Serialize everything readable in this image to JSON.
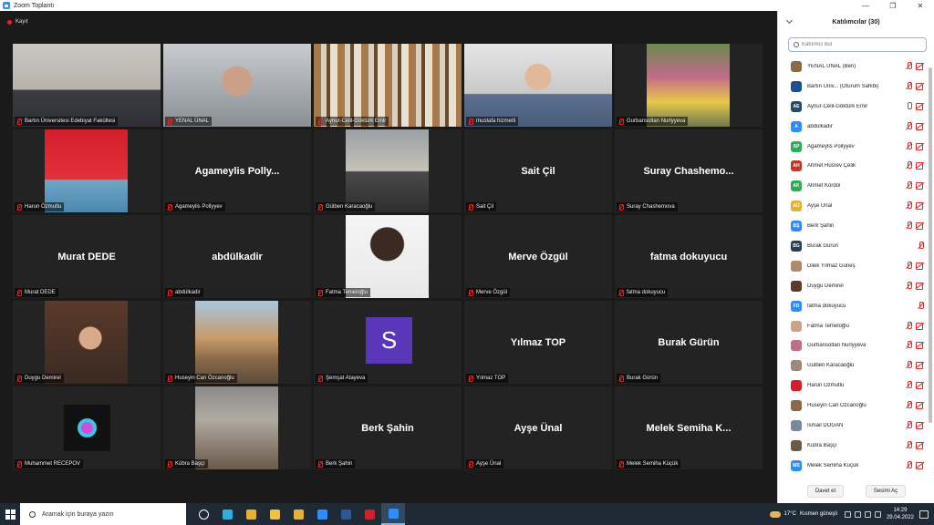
{
  "window": {
    "title": "Zoom Toplantı",
    "controls": [
      "—",
      "❐",
      "✕"
    ]
  },
  "recording": {
    "label": "Kayıt"
  },
  "gallery": {
    "tiles": [
      {
        "name": "Bartın Üniversitesi Edebiyat Fakültesi",
        "big": "",
        "video": "v-office",
        "active": false
      },
      {
        "name": "YENAL ÜNAL",
        "big": "",
        "video": "v-face",
        "active": false
      },
      {
        "name": "Aynur-Celil-Göktürk Emir",
        "big": "",
        "video": "v-shelf",
        "active": true
      },
      {
        "name": "mustafa hizmetli",
        "big": "",
        "video": "v-person",
        "active": false
      },
      {
        "name": "Gurbansoltan Nurlyyeva",
        "big": "",
        "video": "v-photo1",
        "active": false
      },
      {
        "name": "Harun Özmutlu",
        "big": "",
        "video": "v-flag",
        "active": false
      },
      {
        "name": "Agameylis Pollyyev",
        "big": "Agameylis  Polly...",
        "video": "",
        "active": false
      },
      {
        "name": "Gülben Karacaoğlu",
        "big": "",
        "video": "v-building",
        "active": false
      },
      {
        "name": "Sait Çil",
        "big": "Sait Çil",
        "video": "",
        "active": false
      },
      {
        "name": "Suray Chashemova",
        "big": "Suray  Chashemo...",
        "video": "",
        "active": false
      },
      {
        "name": "Murat DEDE",
        "big": "Murat DEDE",
        "video": "",
        "active": false
      },
      {
        "name": "abdülkadir",
        "big": "abdülkadir",
        "video": "",
        "active": false
      },
      {
        "name": "Fatma Temeloğlu",
        "big": "",
        "video": "v-portrait",
        "active": false
      },
      {
        "name": "Merve Özgül",
        "big": "Merve Özgül",
        "video": "",
        "active": false
      },
      {
        "name": "fatma dokuyucu",
        "big": "fatma dokuyucu",
        "video": "",
        "active": false
      },
      {
        "name": "Duygu Demirel",
        "big": "",
        "video": "v-girl",
        "active": false
      },
      {
        "name": "Huseyin Can Özcanoğlu",
        "big": "",
        "video": "v-autumn",
        "active": false
      },
      {
        "name": "Şemşat Atayeva",
        "big": "",
        "video": "avatar-s",
        "active": false
      },
      {
        "name": "Yılmaz TOP",
        "big": "Yılmaz TOP",
        "video": "",
        "active": false
      },
      {
        "name": "Burak Gürün",
        "big": "Burak Gürün",
        "video": "",
        "active": false
      },
      {
        "name": "Muhammet RECEPOV",
        "big": "",
        "video": "v-dark",
        "active": false
      },
      {
        "name": "Kübra Başçı",
        "big": "",
        "video": "v-arch",
        "active": false
      },
      {
        "name": "Berk Şahin",
        "big": "Berk Şahin",
        "video": "",
        "active": false
      },
      {
        "name": "Ayşe Ünal",
        "big": "Ayşe Ünal",
        "video": "",
        "active": false
      },
      {
        "name": "Melek Semiha Küçük",
        "big": "Melek Semiha  K...",
        "video": "",
        "active": false
      }
    ],
    "avatar_letter": "S"
  },
  "participants": {
    "title": "Katılımcılar (30)",
    "search_placeholder": "Katılımcı bul",
    "list": [
      {
        "initials": "",
        "color": "#8a6a4a",
        "name": "YENAL ÜNAL (Ben)",
        "mic": "muted",
        "cam": true
      },
      {
        "initials": "",
        "color": "#1f4e8c",
        "name": "Bartın Üniv...  (Oturum Sahibi)",
        "mic": "muted",
        "cam": true
      },
      {
        "initials": "AE",
        "color": "#2a4a6a",
        "name": "Aynur-Celil-Göktürk Emir",
        "mic": "on",
        "cam": true
      },
      {
        "initials": "A",
        "color": "#2d8cff",
        "name": "abdülkadir",
        "mic": "muted",
        "cam": true
      },
      {
        "initials": "AP",
        "color": "#2eaa5a",
        "name": "Agameylis Pollyyev",
        "mic": "muted",
        "cam": true
      },
      {
        "initials": "AH",
        "color": "#c8322a",
        "name": "Ahmet Hüsrev Çelik",
        "mic": "muted",
        "cam": true
      },
      {
        "initials": "AK",
        "color": "#2eaa5a",
        "name": "Ahmet Kördöl",
        "mic": "muted",
        "cam": true
      },
      {
        "initials": "AÜ",
        "color": "#e8b030",
        "name": "Ayşe Ünal",
        "mic": "muted",
        "cam": true
      },
      {
        "initials": "BŞ",
        "color": "#2d8cff",
        "name": "Berk Şahin",
        "mic": "muted",
        "cam": true
      },
      {
        "initials": "BG",
        "color": "#2a3e52",
        "name": "Burak Gürün",
        "mic": "muted",
        "cam": false
      },
      {
        "initials": "",
        "color": "#b08a6a",
        "name": "Dilek Yılmaz Güneş",
        "mic": "muted",
        "cam": true
      },
      {
        "initials": "",
        "color": "#5a3a2a",
        "name": "Duygu Demirel",
        "mic": "muted",
        "cam": true
      },
      {
        "initials": "FD",
        "color": "#2d8cff",
        "name": "fatma dokuyucu",
        "mic": "muted",
        "cam": false
      },
      {
        "initials": "",
        "color": "#c8a48a",
        "name": "Fatma Temeloğlu",
        "mic": "muted",
        "cam": true
      },
      {
        "initials": "",
        "color": "#c26b8a",
        "name": "Gurbansoltan Nurlyyeva",
        "mic": "muted",
        "cam": true
      },
      {
        "initials": "",
        "color": "#9a8a7a",
        "name": "Gülben Karacaoğlu",
        "mic": "muted",
        "cam": true
      },
      {
        "initials": "",
        "color": "#d21f2a",
        "name": "Harun Özmutlu",
        "mic": "muted",
        "cam": true
      },
      {
        "initials": "",
        "color": "#8a6a4a",
        "name": "Huseyin Can Özcanoğlu",
        "mic": "muted",
        "cam": true
      },
      {
        "initials": "",
        "color": "#7a8a9a",
        "name": "İsmail DOĞAN",
        "mic": "muted",
        "cam": true
      },
      {
        "initials": "",
        "color": "#6a5a4a",
        "name": "Kübra Başçı",
        "mic": "muted",
        "cam": true
      },
      {
        "initials": "MS",
        "color": "#2d8cff",
        "name": "Melek Semiha Küçük",
        "mic": "muted",
        "cam": true
      }
    ],
    "invite_label": "Davet et",
    "unmute_label": "Sesimi Aç"
  },
  "taskbar": {
    "search_placeholder": "Aramak için buraya yazın",
    "apps": [
      {
        "name": "task-view-icon",
        "color": "#ffffff"
      },
      {
        "name": "edge-icon",
        "color": "#2fb0d8"
      },
      {
        "name": "chrome-icon",
        "color": "#e8b030"
      },
      {
        "name": "file-explorer-icon",
        "color": "#f0c040"
      },
      {
        "name": "folder-icon",
        "color": "#e8b030"
      },
      {
        "name": "mail-icon",
        "color": "#2d8cff"
      },
      {
        "name": "word-icon",
        "color": "#2b579a"
      },
      {
        "name": "acrobat-icon",
        "color": "#d21f2a"
      },
      {
        "name": "zoom-icon",
        "color": "#2d8cff"
      }
    ],
    "weather_temp": "17°C",
    "weather_text": "Kısmen güneşli",
    "time": "14:29",
    "date": "29.04.2022"
  }
}
